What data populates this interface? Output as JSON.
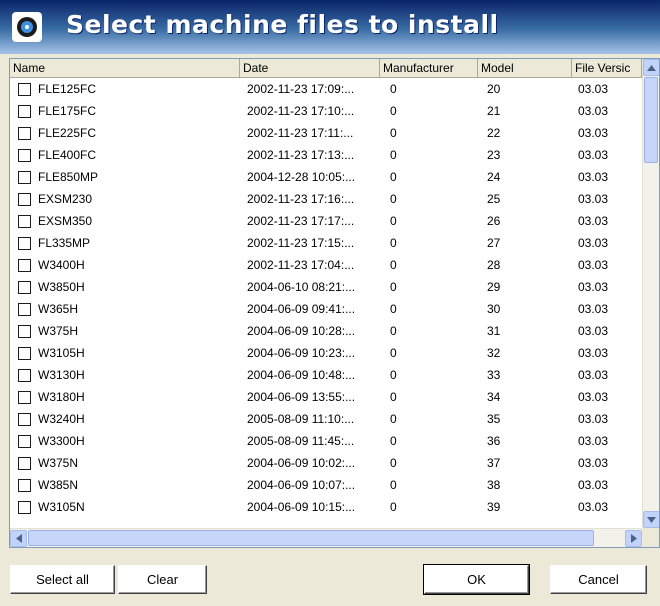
{
  "window": {
    "title": "Select machine files to install",
    "title_icon": "disc-icon"
  },
  "columns": [
    "Name",
    "Date",
    "Manufacturer",
    "Model",
    "File Versic"
  ],
  "rows": [
    {
      "name": "FLE125FC",
      "date": "2002-11-23 17:09:...",
      "manufacturer": "0",
      "model": "20",
      "version": "03.03",
      "checked": false
    },
    {
      "name": "FLE175FC",
      "date": "2002-11-23 17:10:...",
      "manufacturer": "0",
      "model": "21",
      "version": "03.03",
      "checked": false
    },
    {
      "name": "FLE225FC",
      "date": "2002-11-23 17:11:...",
      "manufacturer": "0",
      "model": "22",
      "version": "03.03",
      "checked": false
    },
    {
      "name": "FLE400FC",
      "date": "2002-11-23 17:13:...",
      "manufacturer": "0",
      "model": "23",
      "version": "03.03",
      "checked": false
    },
    {
      "name": "FLE850MP",
      "date": "2004-12-28 10:05:...",
      "manufacturer": "0",
      "model": "24",
      "version": "03.03",
      "checked": false
    },
    {
      "name": "EXSM230",
      "date": "2002-11-23 17:16:...",
      "manufacturer": "0",
      "model": "25",
      "version": "03.03",
      "checked": false
    },
    {
      "name": "EXSM350",
      "date": "2002-11-23 17:17:...",
      "manufacturer": "0",
      "model": "26",
      "version": "03.03",
      "checked": false
    },
    {
      "name": "FL335MP",
      "date": "2002-11-23 17:15:...",
      "manufacturer": "0",
      "model": "27",
      "version": "03.03",
      "checked": false
    },
    {
      "name": "W3400H",
      "date": "2002-11-23 17:04:...",
      "manufacturer": "0",
      "model": "28",
      "version": "03.03",
      "checked": false
    },
    {
      "name": "W3850H",
      "date": "2004-06-10 08:21:...",
      "manufacturer": "0",
      "model": "29",
      "version": "03.03",
      "checked": false
    },
    {
      "name": "W365H",
      "date": "2004-06-09 09:41:...",
      "manufacturer": "0",
      "model": "30",
      "version": "03.03",
      "checked": false
    },
    {
      "name": "W375H",
      "date": "2004-06-09 10:28:...",
      "manufacturer": "0",
      "model": "31",
      "version": "03.03",
      "checked": false
    },
    {
      "name": "W3105H",
      "date": "2004-06-09 10:23:...",
      "manufacturer": "0",
      "model": "32",
      "version": "03.03",
      "checked": false
    },
    {
      "name": "W3130H",
      "date": "2004-06-09 10:48:...",
      "manufacturer": "0",
      "model": "33",
      "version": "03.03",
      "checked": false
    },
    {
      "name": "W3180H",
      "date": "2004-06-09 13:55:...",
      "manufacturer": "0",
      "model": "34",
      "version": "03.03",
      "checked": false
    },
    {
      "name": "W3240H",
      "date": "2005-08-09 11:10:...",
      "manufacturer": "0",
      "model": "35",
      "version": "03.03",
      "checked": false
    },
    {
      "name": "W3300H",
      "date": "2005-08-09 11:45:...",
      "manufacturer": "0",
      "model": "36",
      "version": "03.03",
      "checked": false
    },
    {
      "name": "W375N",
      "date": "2004-06-09 10:02:...",
      "manufacturer": "0",
      "model": "37",
      "version": "03.03",
      "checked": false
    },
    {
      "name": "W385N",
      "date": "2004-06-09 10:07:...",
      "manufacturer": "0",
      "model": "38",
      "version": "03.03",
      "checked": false
    },
    {
      "name": "W3105N",
      "date": "2004-06-09 10:15:...",
      "manufacturer": "0",
      "model": "39",
      "version": "03.03",
      "checked": false
    }
  ],
  "buttons": {
    "select_all": "Select all",
    "clear": "Clear",
    "ok": "OK",
    "cancel": "Cancel"
  },
  "colors": {
    "title_bar": "#0a246a",
    "title_bar_light": "#a6c3e8",
    "dialog_bg": "#ece9d8",
    "list_bg": "#ffffff",
    "scrollbar": "#c1d3fb"
  }
}
